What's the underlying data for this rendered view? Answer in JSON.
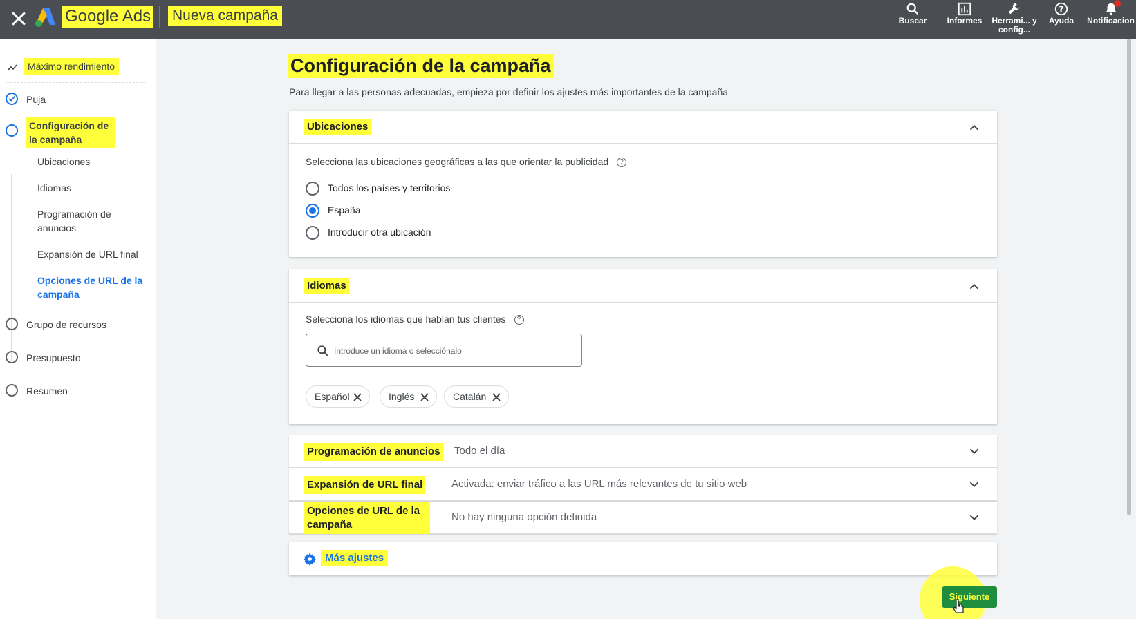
{
  "header": {
    "brand": "Google Ads",
    "campaign_title": "Nueva campaña",
    "tools": [
      {
        "label": "Buscar",
        "icon": "search-icon"
      },
      {
        "label": "Informes",
        "icon": "bar-chart-icon"
      },
      {
        "label": "Herrami... y config...",
        "icon": "wrench-icon"
      },
      {
        "label": "Ayuda",
        "icon": "help-icon"
      },
      {
        "label": "Notificacion",
        "icon": "bell-icon"
      }
    ]
  },
  "sidebar": {
    "top_label": "Máximo rendimiento",
    "steps": [
      {
        "label": "Puja",
        "state": "done"
      },
      {
        "label": "Configuración de la campaña",
        "state": "current"
      },
      {
        "label": "Grupo de recursos",
        "state": "pending"
      },
      {
        "label": "Presupuesto",
        "state": "pending"
      },
      {
        "label": "Resumen",
        "state": "pending"
      }
    ],
    "subitems": [
      {
        "label": "Ubicaciones"
      },
      {
        "label": "Idiomas"
      },
      {
        "label": "Programación de anuncios"
      },
      {
        "label": "Expansión de URL final"
      },
      {
        "label": "Opciones de URL de la campaña"
      }
    ]
  },
  "main": {
    "title": "Configuración de la campaña",
    "description": "Para llegar a las personas adecuadas, empieza por definir los ajustes más importantes de la campaña",
    "locations": {
      "title": "Ubicaciones",
      "prompt": "Selecciona las ubicaciones geográficas a las que orientar la publicidad",
      "options": [
        "Todos los países y territorios",
        "España",
        "Introducir otra ubicación"
      ],
      "selected": "España"
    },
    "languages": {
      "title": "Idiomas",
      "prompt": "Selecciona los idiomas que hablan tus clientes",
      "placeholder": "Introduce un idioma o selecciónalo",
      "chips": [
        "Español",
        "Inglés",
        "Catalán"
      ]
    },
    "rows": [
      {
        "title": "Programación de anuncios",
        "value": "Todo el día"
      },
      {
        "title": "Expansión de URL final",
        "value": "Activada: enviar tráfico a las URL más relevantes de tu sitio web"
      },
      {
        "title": "Opciones de URL de la campaña",
        "value": "No hay ninguna opción definida"
      }
    ],
    "more_settings": "Más ajustes",
    "next_label": "Siguiente"
  },
  "colors": {
    "accent": "#1a73e8",
    "highlight": "#ffff3a",
    "topbar": "#4a4d51",
    "next_button": "#1e8e3e"
  }
}
